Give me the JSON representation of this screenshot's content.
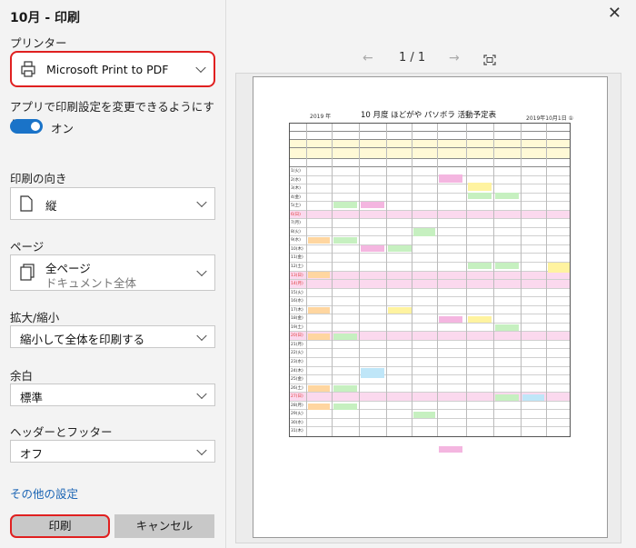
{
  "dialog": {
    "title": "10月 - 印刷"
  },
  "printer": {
    "label": "プリンター",
    "value": "Microsoft Print to PDF"
  },
  "app_settings": {
    "label": "アプリで印刷設定を変更できるようにする",
    "toggle_state": "オン"
  },
  "orientation": {
    "label": "印刷の向き",
    "value": "縦"
  },
  "pages": {
    "label": "ページ",
    "value": "全ページ",
    "sub": "ドキュメント全体"
  },
  "scale": {
    "label": "拡大/縮小",
    "value": "縮小して全体を印刷する"
  },
  "margins": {
    "label": "余白",
    "value": "標準"
  },
  "header_footer": {
    "label": "ヘッダーとフッター",
    "value": "オフ"
  },
  "more_settings": "その他の設定",
  "buttons": {
    "print": "印刷",
    "cancel": "キャンセル"
  },
  "preview": {
    "page_indicator": "1 / 1",
    "doc": {
      "year": "2019 年",
      "title": "10 月度 ほどがや パソボラ 活動予定表",
      "date": "2019年10月1日  ①"
    }
  },
  "colors": {
    "accent": "#1a73c8",
    "highlight": "#e02020",
    "link": "#1a64b4"
  }
}
